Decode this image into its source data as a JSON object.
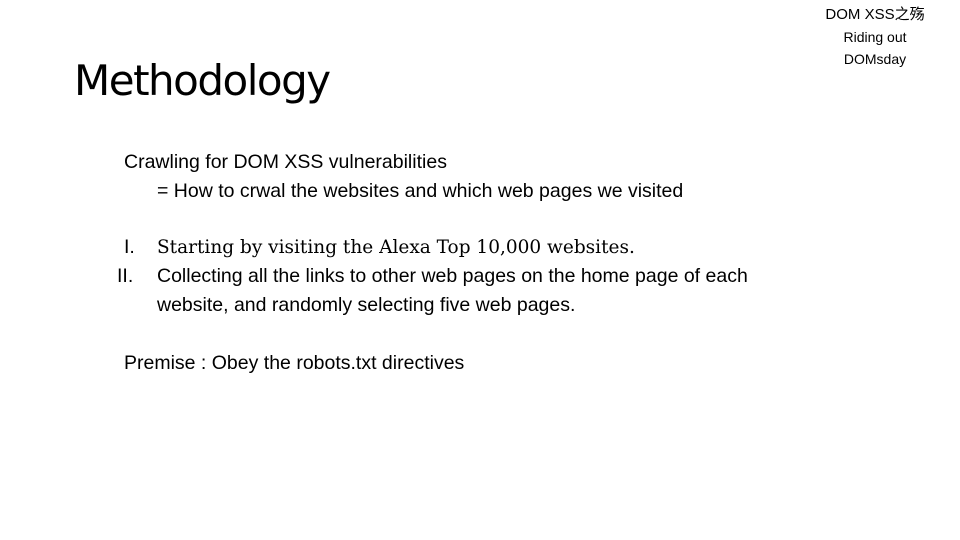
{
  "header": {
    "corner_lines": [
      "DOM XSS之殇",
      "Riding out",
      "DOMsday"
    ]
  },
  "slide": {
    "title": "Methodology",
    "intro": {
      "heading": "Crawling for DOM XSS vulnerabilities",
      "subline": "= How to crwal the websites and which web pages we visited"
    },
    "steps": [
      {
        "marker": "I.",
        "text": "Starting by visiting the Alexa Top 10,000 websites."
      },
      {
        "marker": "II.",
        "text": "Collecting all the links to other web pages on the home page of each website, and randomly selecting five web pages."
      }
    ],
    "premise": "Premise : Obey the robots.txt directives"
  }
}
